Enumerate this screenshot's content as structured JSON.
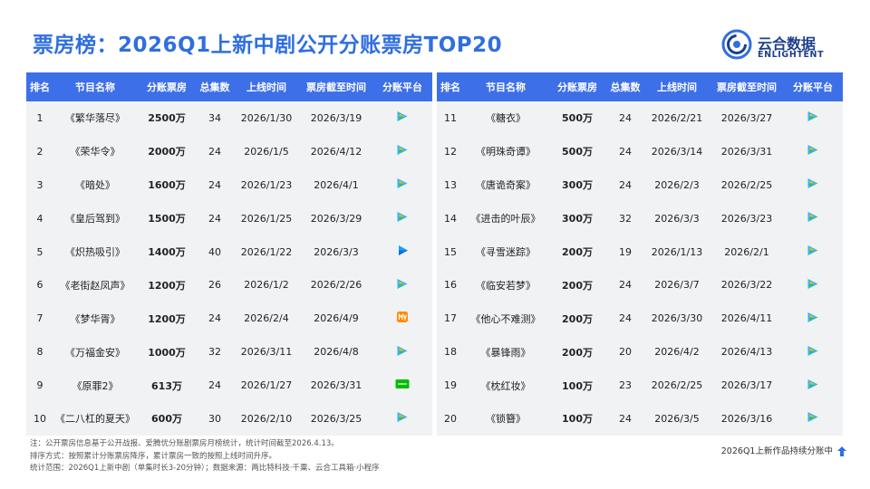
{
  "title": "票房榜：2026Q1上新中剧公开分账票房TOP20",
  "brand": {
    "cn": "云合数据",
    "en": "ENLIGHTENT",
    "color": "#1d3f8a"
  },
  "colors": {
    "accent": "#3d6fe8",
    "title": "#2f6fe0",
    "row_bg": "#f1f2f4"
  },
  "headers": [
    "排名",
    "节目名称",
    "分账票房",
    "总集数",
    "上线时间",
    "票房截至时间",
    "分账平台"
  ],
  "left_rows": [
    {
      "rank": "1",
      "name": "《繁华落尽》",
      "box": "2500万",
      "eps": "34",
      "start": "2026/1/30",
      "end": "2026/3/19",
      "platform": "tencent-video-icon"
    },
    {
      "rank": "2",
      "name": "《荣华令》",
      "box": "2000万",
      "eps": "24",
      "start": "2026/1/5",
      "end": "2026/4/12",
      "platform": "tencent-video-icon"
    },
    {
      "rank": "3",
      "name": "《暗处》",
      "box": "1600万",
      "eps": "24",
      "start": "2026/1/23",
      "end": "2026/4/1",
      "platform": "tencent-video-icon"
    },
    {
      "rank": "4",
      "name": "《皇后驾到》",
      "box": "1500万",
      "eps": "24",
      "start": "2026/1/25",
      "end": "2026/3/29",
      "platform": "tencent-video-icon"
    },
    {
      "rank": "5",
      "name": "《炽热吸引》",
      "box": "1400万",
      "eps": "40",
      "start": "2026/1/22",
      "end": "2026/3/3",
      "platform": "youku-icon"
    },
    {
      "rank": "6",
      "name": "《老街赵凤声》",
      "box": "1200万",
      "eps": "26",
      "start": "2026/1/2",
      "end": "2026/2/26",
      "platform": "tencent-video-icon"
    },
    {
      "rank": "7",
      "name": "《梦华胥》",
      "box": "1200万",
      "eps": "24",
      "start": "2026/2/4",
      "end": "2026/4/9",
      "platform": "mango-tv-icon"
    },
    {
      "rank": "8",
      "name": "《万福金安》",
      "box": "1000万",
      "eps": "32",
      "start": "2026/3/11",
      "end": "2026/4/8",
      "platform": "tencent-video-icon"
    },
    {
      "rank": "9",
      "name": "《原罪2》",
      "box": "613万",
      "eps": "24",
      "start": "2026/1/27",
      "end": "2026/3/31",
      "platform": "iqiyi-icon"
    },
    {
      "rank": "10",
      "name": "《二八杠的夏天》",
      "box": "600万",
      "eps": "30",
      "start": "2026/2/10",
      "end": "2026/3/25",
      "platform": "tencent-video-icon"
    }
  ],
  "right_rows": [
    {
      "rank": "11",
      "name": "《糖衣》",
      "box": "500万",
      "eps": "24",
      "start": "2026/2/21",
      "end": "2026/3/27",
      "platform": "tencent-video-icon"
    },
    {
      "rank": "12",
      "name": "《明珠奇谭》",
      "box": "500万",
      "eps": "24",
      "start": "2026/3/14",
      "end": "2026/3/31",
      "platform": "tencent-video-icon"
    },
    {
      "rank": "13",
      "name": "《唐诡奇案》",
      "box": "300万",
      "eps": "24",
      "start": "2026/2/3",
      "end": "2026/2/25",
      "platform": "tencent-video-icon"
    },
    {
      "rank": "14",
      "name": "《进击的叶辰》",
      "box": "300万",
      "eps": "32",
      "start": "2026/3/3",
      "end": "2026/3/23",
      "platform": "tencent-video-icon"
    },
    {
      "rank": "15",
      "name": "《寻雪迷踪》",
      "box": "200万",
      "eps": "19",
      "start": "2026/1/13",
      "end": "2026/2/1",
      "platform": "tencent-video-icon"
    },
    {
      "rank": "16",
      "name": "《临安若梦》",
      "box": "200万",
      "eps": "24",
      "start": "2026/3/7",
      "end": "2026/3/22",
      "platform": "tencent-video-icon"
    },
    {
      "rank": "17",
      "name": "《他心不难测》",
      "box": "200万",
      "eps": "24",
      "start": "2026/3/30",
      "end": "2026/4/11",
      "platform": "tencent-video-icon"
    },
    {
      "rank": "18",
      "name": "《暴锋雨》",
      "box": "200万",
      "eps": "20",
      "start": "2026/4/2",
      "end": "2026/4/13",
      "platform": "tencent-video-icon"
    },
    {
      "rank": "19",
      "name": "《枕红妆》",
      "box": "100万",
      "eps": "23",
      "start": "2026/2/25",
      "end": "2026/3/17",
      "platform": "tencent-video-icon"
    },
    {
      "rank": "20",
      "name": "《锁簪》",
      "box": "100万",
      "eps": "24",
      "start": "2026/3/5",
      "end": "2026/3/16",
      "platform": "tencent-video-icon"
    }
  ],
  "notes": [
    "注：公开票房信息基于公开战报、爱腾优分账剧票房月榜统计，统计时间截至2026.4.13。",
    "排序方式：按照累计分账票房降序，累计票房一致的按照上线时间升序。",
    "统计范围：2026Q1上新中剧（单集时长3-20分钟）；数据来源：两比特科技·千粟、云合工具箱·小程序"
  ],
  "promo": "2026Q1上新作品持续分账中"
}
